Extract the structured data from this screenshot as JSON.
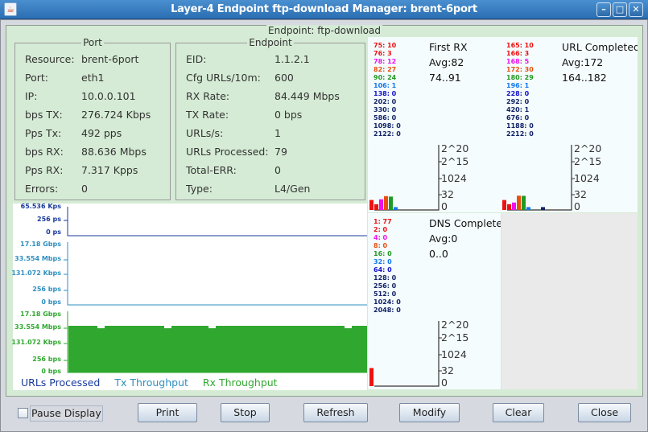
{
  "window": {
    "title": "Layer-4 Endpoint ftp-download  Manager: brent-6port",
    "app_icon": "java-icon",
    "controls": [
      "minimize",
      "maximize",
      "close"
    ]
  },
  "panel_title": "Endpoint: ftp-download",
  "port_group": {
    "title": "Port",
    "rows": [
      {
        "label": "Resource:",
        "value": "brent-6port"
      },
      {
        "label": "Port:",
        "value": "eth1"
      },
      {
        "label": "IP:",
        "value": "10.0.0.101"
      },
      {
        "label": "bps TX:",
        "value": "276.724 Kbps"
      },
      {
        "label": "Pps Tx:",
        "value": "492 pps"
      },
      {
        "label": "bps RX:",
        "value": "88.636 Mbps"
      },
      {
        "label": "Pps RX:",
        "value": "7.317 Kpps"
      },
      {
        "label": "Errors:",
        "value": "0"
      }
    ]
  },
  "endpoint_group": {
    "title": "Endpoint",
    "rows": [
      {
        "label": "EID:",
        "value": "1.1.2.1"
      },
      {
        "label": "Cfg URLs/10m:",
        "value": "600"
      },
      {
        "label": "RX Rate:",
        "value": "84.449 Mbps"
      },
      {
        "label": "TX Rate:",
        "value": "0 bps"
      },
      {
        "label": "URLs/s:",
        "value": "1"
      },
      {
        "label": "URLs Processed:",
        "value": "79"
      },
      {
        "label": "Total-ERR:",
        "value": "0"
      },
      {
        "label": "Type:",
        "value": "L4/Gen"
      }
    ]
  },
  "histogram_axis_labels": [
    "2^20",
    "2^15",
    "1024",
    "32",
    "0"
  ],
  "bucket_colors": [
    "#ee1111",
    "#ee1111",
    "#ee11ee",
    "#e85010",
    "#229922",
    "#1177ee",
    "#1111cc",
    "#112266",
    "#112266",
    "#112266",
    "#112266",
    "#112266"
  ],
  "histograms": [
    {
      "title": "First RX",
      "avg": "Avg:82",
      "range": "74..91",
      "buckets": [
        {
          "label": "75: 10",
          "count": 10
        },
        {
          "label": "76: 3",
          "count": 3
        },
        {
          "label": "78: 12",
          "count": 12
        },
        {
          "label": "82: 27",
          "count": 27
        },
        {
          "label": "90: 24",
          "count": 24
        },
        {
          "label": "106: 1",
          "count": 1
        },
        {
          "label": "138: 0",
          "count": 0
        },
        {
          "label": "202: 0",
          "count": 0
        },
        {
          "label": "330: 0",
          "count": 0
        },
        {
          "label": "586: 0",
          "count": 0
        },
        {
          "label": "1098: 0",
          "count": 0
        },
        {
          "label": "2122: 0",
          "count": 0
        }
      ]
    },
    {
      "title": "URL Completed",
      "avg": "Avg:172",
      "range": "164..182",
      "buckets": [
        {
          "label": "165: 10",
          "count": 10
        },
        {
          "label": "166: 3",
          "count": 3
        },
        {
          "label": "168: 5",
          "count": 5
        },
        {
          "label": "172: 30",
          "count": 30
        },
        {
          "label": "180: 29",
          "count": 29
        },
        {
          "label": "196: 1",
          "count": 1
        },
        {
          "label": "228: 0",
          "count": 0
        },
        {
          "label": "292: 0",
          "count": 0
        },
        {
          "label": "420: 1",
          "count": 1
        },
        {
          "label": "676: 0",
          "count": 0
        },
        {
          "label": "1188: 0",
          "count": 0
        },
        {
          "label": "2212: 0",
          "count": 0
        }
      ]
    },
    {
      "title": "DNS Complete",
      "avg": "Avg:0",
      "range": "0..0",
      "buckets": [
        {
          "label": "1: 77",
          "count": 77
        },
        {
          "label": "2: 0",
          "count": 0
        },
        {
          "label": "4: 0",
          "count": 0
        },
        {
          "label": "8: 0",
          "count": 0
        },
        {
          "label": "16: 0",
          "count": 0
        },
        {
          "label": "32: 0",
          "count": 0
        },
        {
          "label": "64: 0",
          "count": 0
        },
        {
          "label": "128: 0",
          "count": 0
        },
        {
          "label": "256: 0",
          "count": 0
        },
        {
          "label": "512: 0",
          "count": 0
        },
        {
          "label": "1024: 0",
          "count": 0
        },
        {
          "label": "2048: 0",
          "count": 0
        }
      ]
    }
  ],
  "graphs": {
    "urls": {
      "color": "#1a3a9c",
      "ticks": [
        "65.536 Kps",
        "256 ps",
        "0 ps"
      ]
    },
    "tx": {
      "color": "#2f8fc0",
      "ticks": [
        "17.18 Gbps",
        "33.554 Mbps",
        "131.072 Kbps",
        "256 bps",
        "0 bps"
      ]
    },
    "rx": {
      "color": "#30a830",
      "ticks": [
        "17.18 Gbps",
        "33.554 Mbps",
        "131.072 Kbps",
        "256 bps",
        "0 bps"
      ],
      "level": "~33.554 Mbps (steady with brief dips)"
    }
  },
  "legend": [
    "URLs Processed",
    "Tx Throughput",
    "Rx Throughput"
  ],
  "controls": {
    "pause_label": "Pause Display",
    "pause_checked": false,
    "buttons": [
      "Print",
      "Stop",
      "Refresh",
      "Modify",
      "Clear",
      "Close"
    ]
  }
}
